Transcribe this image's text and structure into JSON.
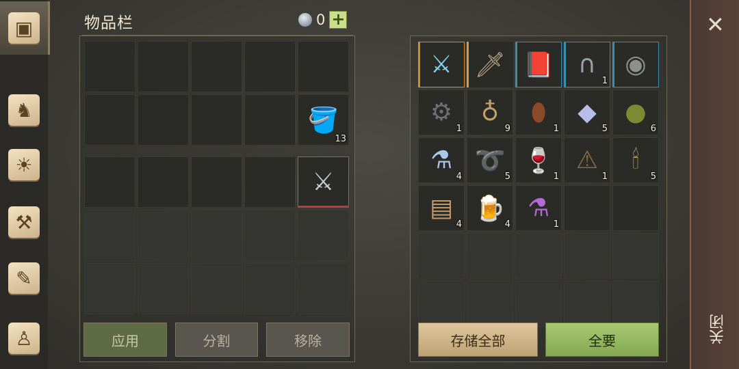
{
  "nav": {
    "tabs": [
      {
        "name": "chest-icon",
        "glyph": "▣",
        "active": true
      },
      {
        "name": "wolf-icon",
        "glyph": "♞",
        "active": false
      },
      {
        "name": "sun-book-icon",
        "glyph": "☀",
        "active": false
      },
      {
        "name": "hammer-map-icon",
        "glyph": "⚒",
        "active": false
      },
      {
        "name": "quill-scroll-icon",
        "glyph": "✎",
        "active": false
      },
      {
        "name": "character-icon",
        "glyph": "♙",
        "active": false
      }
    ]
  },
  "header": {
    "title": "物品栏",
    "currency_count": "0",
    "plus_label": "+"
  },
  "inventory": {
    "rows": [
      [
        null,
        null,
        null,
        null,
        null
      ],
      [
        null,
        null,
        null,
        null,
        {
          "icon": "berry-bucket-icon",
          "glyph": "🪣",
          "qty": "13",
          "color": "#b05a3a"
        }
      ],
      [
        null,
        null,
        null,
        null,
        {
          "icon": "halberd-icon",
          "glyph": "⚔",
          "qty": "",
          "rarity": "red",
          "color": "#c8cdd2"
        }
      ],
      [
        null,
        null,
        null,
        null,
        null
      ],
      [
        null,
        null,
        null,
        null,
        null
      ]
    ],
    "buttons": {
      "apply": "应用",
      "split": "分割",
      "remove": "移除"
    }
  },
  "storage": {
    "rows": [
      [
        {
          "icon": "ice-sword-icon",
          "glyph": "⚔",
          "qty": "",
          "rarity": "orange",
          "color": "#7fd4f0"
        },
        {
          "icon": "long-sword-icon",
          "glyph": "🗡",
          "qty": "",
          "rarity": "tan",
          "color": "#b9a98a"
        },
        {
          "icon": "mask-book-icon",
          "glyph": "📕",
          "qty": "",
          "rarity": "blue",
          "color": "#e3a33a"
        },
        {
          "icon": "horseshoe-icon",
          "glyph": "∩",
          "qty": "1",
          "rarity": "blue",
          "color": "#9aa3aa"
        },
        {
          "icon": "round-shield-icon",
          "glyph": "◉",
          "qty": "",
          "rarity": "blue",
          "color": "#8d8f8c"
        }
      ],
      [
        {
          "icon": "gear-icon",
          "glyph": "⚙",
          "qty": "1",
          "color": "#6d6f72"
        },
        {
          "icon": "grain-sack-icon",
          "glyph": "♁",
          "qty": "9",
          "color": "#c4a06a"
        },
        {
          "icon": "leather-bottle-icon",
          "glyph": "⬮",
          "qty": "1",
          "color": "#8a4a2a"
        },
        {
          "icon": "crystal-icon",
          "glyph": "◆",
          "qty": "5",
          "color": "#b7bde8"
        },
        {
          "icon": "herb-ball-icon",
          "glyph": "●",
          "qty": "6",
          "color": "#7c8a32"
        }
      ],
      [
        {
          "icon": "potion-flask-icon",
          "glyph": "⚗",
          "qty": "4",
          "color": "#a9c7e6"
        },
        {
          "icon": "rope-icon",
          "glyph": "➰",
          "qty": "5",
          "color": "#6a4a3a"
        },
        {
          "icon": "goblet-icon",
          "glyph": "🍷",
          "qty": "1",
          "color": "#c7a15a"
        },
        {
          "icon": "bear-trap-icon",
          "glyph": "⚠",
          "qty": "1",
          "color": "#8a6a4a"
        },
        {
          "icon": "candle-icon",
          "glyph": "🕯",
          "qty": "5",
          "color": "#d9b96a"
        }
      ],
      [
        {
          "icon": "cloth-icon",
          "glyph": "▤",
          "qty": "4",
          "color": "#c49a6c"
        },
        {
          "icon": "wooden-mug-icon",
          "glyph": "🍺",
          "qty": "4",
          "color": "#9a5a3a"
        },
        {
          "icon": "purple-potion-icon",
          "glyph": "⚗",
          "qty": "1",
          "color": "#b36ad6"
        },
        null,
        null
      ],
      [
        null,
        null,
        null,
        null,
        null
      ],
      [
        null,
        null,
        null,
        null,
        null
      ]
    ],
    "buttons": {
      "store_all": "存储全部",
      "take_all": "全要"
    }
  },
  "closebar": {
    "x": "✕",
    "label": "关闭"
  }
}
